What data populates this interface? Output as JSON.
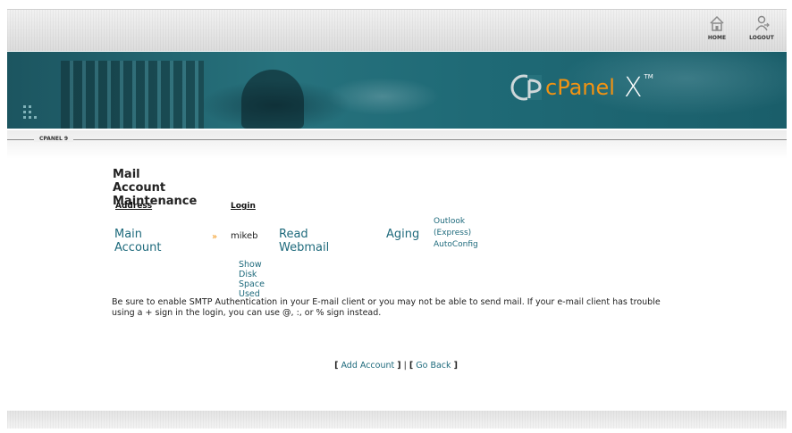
{
  "top_nav": {
    "home_label": "HOME",
    "logout_label": "LOGOUT"
  },
  "banner": {
    "brand": "cPanel",
    "version_mark": "X",
    "tm": "TM"
  },
  "section": {
    "label": "CPANEL 9"
  },
  "page": {
    "title": "Mail Account Maintenance",
    "columns": {
      "address": "Address",
      "login": "Login"
    },
    "account": {
      "name": "Main Account",
      "arrow": "»",
      "login": "mikeb",
      "read_webmail": "Read Webmail",
      "aging": "Aging",
      "outlook_line1": "Outlook",
      "outlook_line2": "(Express)",
      "outlook_line3": "AutoConfig"
    },
    "show_disk": "Show Disk Space Used",
    "note": "Be sure to enable SMTP Authentication in your E-mail client or you may not be able to send mail. If your e-mail client has trouble using a + sign in the login, you can use @, :, or % sign instead.",
    "links": {
      "add_account": "Add Account",
      "go_back": "Go Back",
      "open": "[",
      "close": "]",
      "sep": "|"
    }
  },
  "colors": {
    "accent": "#1e6a7c",
    "brand_orange": "#f29312",
    "banner_teal": "#27727d"
  }
}
